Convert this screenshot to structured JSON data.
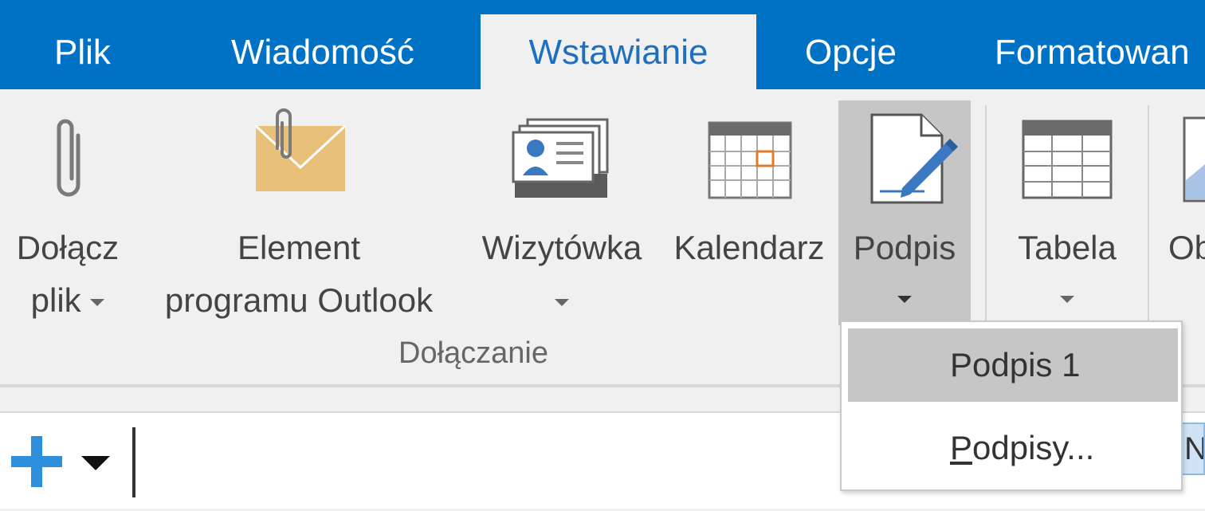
{
  "tabs": {
    "file": "Plik",
    "message": "Wiadomość",
    "insert": "Wstawianie",
    "options": "Opcje",
    "format": "Formatowan"
  },
  "ribbon": {
    "attach_file": {
      "line1": "Dołącz",
      "line2": "plik"
    },
    "outlook_item": {
      "line1": "Element",
      "line2": "programu Outlook"
    },
    "business_card": "Wizytówka",
    "calendar": "Kalendarz",
    "signature": "Podpis",
    "table": "Tabela",
    "picture_partial": "Ob",
    "group_include": "Dołączanie"
  },
  "signature_menu": {
    "items": [
      {
        "label": "Podpis 1"
      },
      {
        "accel": "P",
        "rest": "odpisy..."
      }
    ]
  },
  "lower": {
    "right_partial": "N"
  },
  "colors": {
    "tab_bar": "#0072c6",
    "active_tab_text": "#1e6fbf",
    "ribbon_bg": "#f0f0f0",
    "highlight": "#c6c6c6",
    "accent_blue": "#2e8fdc",
    "envelope": "#e8c07a"
  }
}
